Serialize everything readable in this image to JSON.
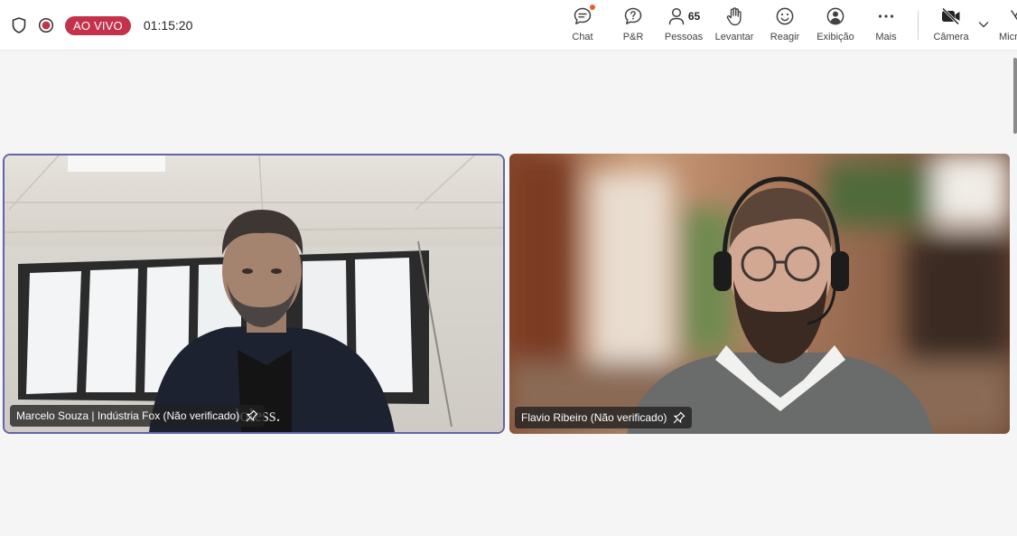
{
  "header": {
    "live_label": "AO VIVO",
    "timer": "01:15:20"
  },
  "toolbar": [
    {
      "id": "chat",
      "label": "Chat",
      "icon": "chat-icon",
      "has_notification": true
    },
    {
      "id": "qa",
      "label": "P&R",
      "icon": "qa-icon"
    },
    {
      "id": "people",
      "label": "Pessoas",
      "icon": "people-icon",
      "count": "65"
    },
    {
      "id": "raise",
      "label": "Levantar",
      "icon": "raise-hand-icon"
    },
    {
      "id": "react",
      "label": "Reagir",
      "icon": "smile-icon"
    },
    {
      "id": "view",
      "label": "Exibição",
      "icon": "view-icon"
    },
    {
      "id": "more",
      "label": "Mais",
      "icon": "more-icon"
    },
    {
      "id": "camera",
      "label": "Câmera",
      "icon": "camera-off-icon"
    },
    {
      "id": "mic",
      "label": "Micr",
      "icon": "mic-off-icon"
    }
  ],
  "participants": [
    {
      "name": "Marcelo Souza | Indústria Fox (Não verificado)",
      "active_speaker": true,
      "shirt_text": "loless."
    },
    {
      "name": "Flavio Ribeiro (Não verificado)",
      "active_speaker": false
    }
  ],
  "colors": {
    "live_badge": "#c4314b",
    "active_speaker_border": "#6264a7",
    "notification_dot": "#e95e2f"
  }
}
